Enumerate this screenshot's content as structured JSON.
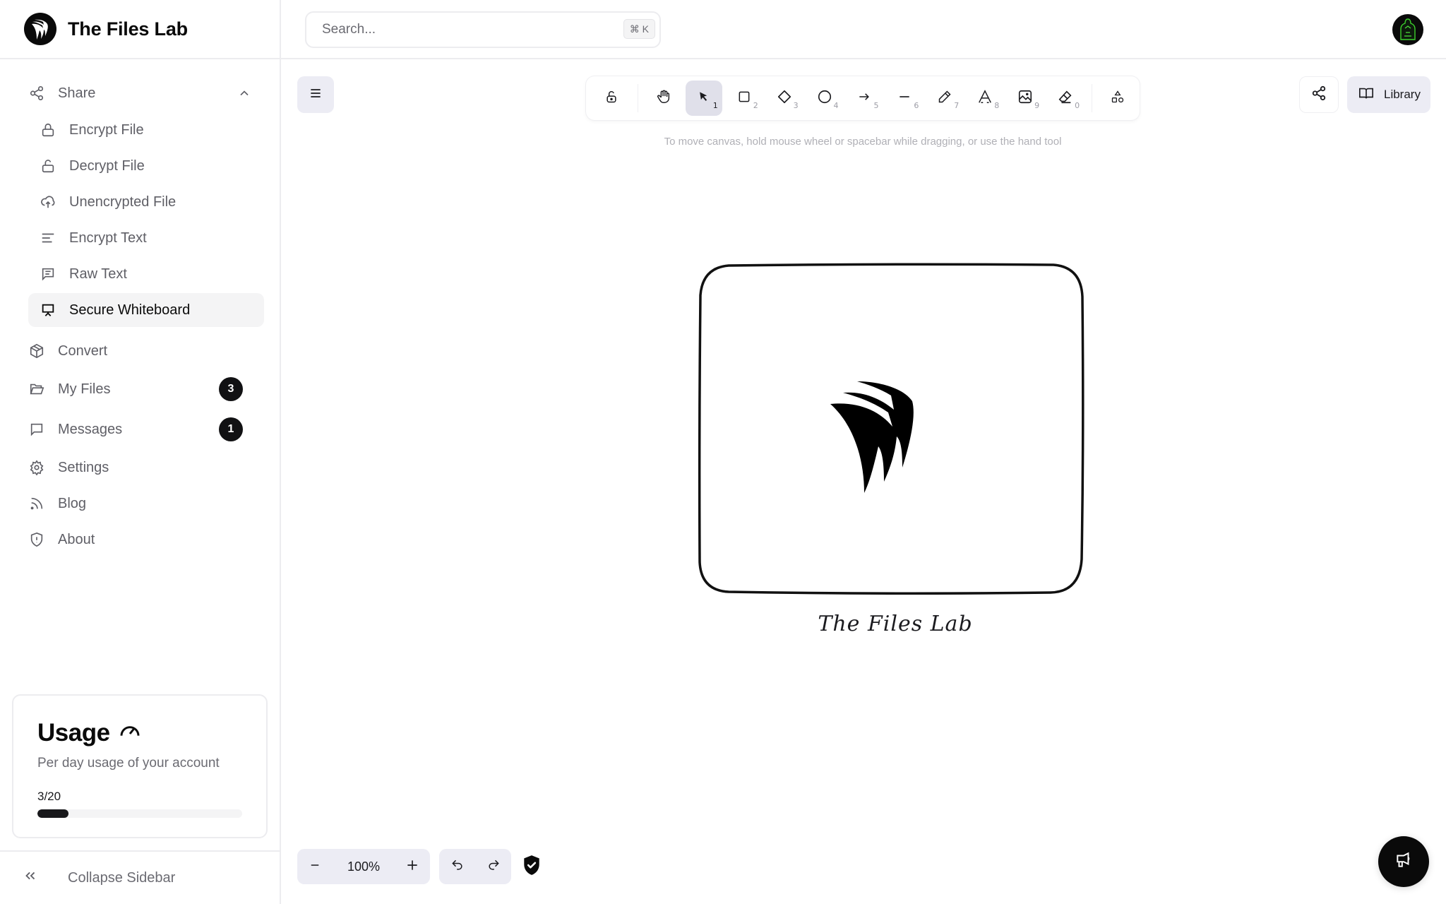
{
  "app": {
    "name": "The Files Lab"
  },
  "search": {
    "placeholder": "Search...",
    "value": "",
    "shortcut": "⌘ K"
  },
  "sidebar": {
    "share": {
      "label": "Share",
      "icon": "share-icon",
      "expanded": true,
      "children": [
        {
          "label": "Encrypt File",
          "icon": "lock-icon"
        },
        {
          "label": "Decrypt File",
          "icon": "unlock-icon"
        },
        {
          "label": "Unencrypted File",
          "icon": "cloud-upload-icon"
        },
        {
          "label": "Encrypt Text",
          "icon": "text-lines-icon"
        },
        {
          "label": "Raw Text",
          "icon": "message-square-text-icon"
        },
        {
          "label": "Secure Whiteboard",
          "icon": "presentation-icon",
          "active": true
        }
      ]
    },
    "items": [
      {
        "label": "Convert",
        "icon": "package-icon"
      },
      {
        "label": "My Files",
        "icon": "folder-open-icon",
        "badge": "3"
      },
      {
        "label": "Messages",
        "icon": "message-square-icon",
        "badge": "1"
      },
      {
        "label": "Settings",
        "icon": "gear-icon"
      },
      {
        "label": "Blog",
        "icon": "rss-icon"
      },
      {
        "label": "About",
        "icon": "shield-alert-icon"
      }
    ],
    "usage": {
      "title": "Usage",
      "description": "Per day usage of your account",
      "used": 3,
      "limit": 20,
      "count_label": "3/20",
      "fraction": 0.15
    },
    "collapse_label": "Collapse Sidebar"
  },
  "whiteboard": {
    "toolbar": [
      {
        "name": "lock",
        "icon": "unlock-icon",
        "key": ""
      },
      {
        "name": "hand",
        "icon": "hand-icon",
        "key": ""
      },
      {
        "name": "selection",
        "icon": "pointer-icon",
        "key": "1",
        "active": true
      },
      {
        "name": "rectangle",
        "icon": "square-icon",
        "key": "2"
      },
      {
        "name": "diamond",
        "icon": "diamond-icon",
        "key": "3"
      },
      {
        "name": "ellipse",
        "icon": "circle-icon",
        "key": "4"
      },
      {
        "name": "arrow",
        "icon": "arrow-right-icon",
        "key": "5"
      },
      {
        "name": "line",
        "icon": "line-icon",
        "key": "6"
      },
      {
        "name": "draw",
        "icon": "pencil-icon",
        "key": "7"
      },
      {
        "name": "text",
        "icon": "text-icon",
        "key": "8"
      },
      {
        "name": "image",
        "icon": "image-icon",
        "key": "9"
      },
      {
        "name": "eraser",
        "icon": "eraser-icon",
        "key": "0"
      },
      {
        "name": "more-shapes",
        "icon": "shapes-icon",
        "key": ""
      }
    ],
    "hint": "To move canvas, hold mouse wheel or spacebar while dragging, or use the hand tool",
    "library_label": "Library",
    "canvas_caption": "The Files Lab",
    "zoom_level": "100%"
  }
}
